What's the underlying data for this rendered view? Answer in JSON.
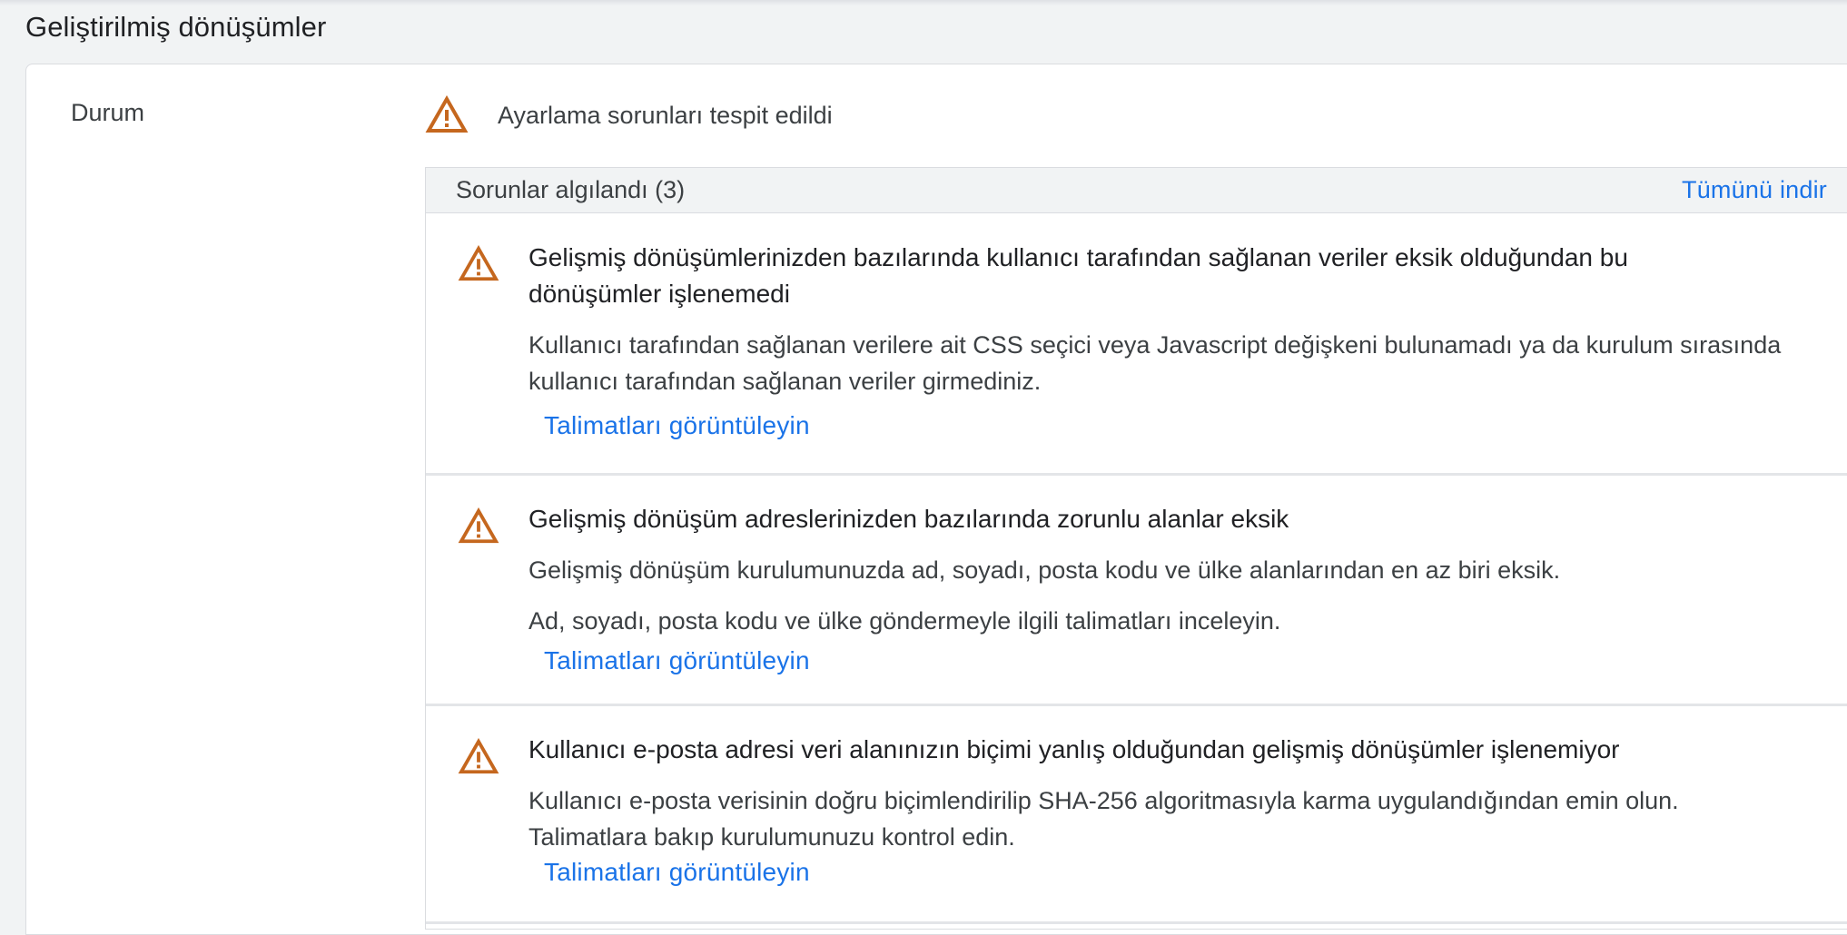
{
  "page": {
    "title": "Geliştirilmiş dönüşümler"
  },
  "status_row": {
    "label": "Durum",
    "status_text": "Ayarlama sorunları tespit edildi",
    "status_icon": "warning-icon",
    "warning_color": "#c5671e"
  },
  "issues": {
    "header": "Sorunlar algılandı (3)",
    "download_all": "Tümünü indir",
    "items": [
      {
        "title": "Gelişmiş dönüşümlerinizden bazılarında kullanıcı tarafından sağlanan veriler eksik olduğundan bu dönüşümler işlenemedi",
        "description": "Kullanıcı tarafından sağlanan verilere ait CSS seçici veya Javascript değişkeni bulunamadı ya da kurulum sırasında kullanıcı tarafından sağlanan veriler girmediniz.",
        "description2": "",
        "link": "Talimatları görüntüleyin"
      },
      {
        "title": "Gelişmiş dönüşüm adreslerinizden bazılarında zorunlu alanlar eksik",
        "description": "Gelişmiş dönüşüm kurulumunuzda ad, soyadı, posta kodu ve ülke alanlarından en az biri eksik.",
        "description2": "Ad, soyadı, posta kodu ve ülke göndermeyle ilgili talimatları inceleyin.",
        "link": "Talimatları görüntüleyin"
      },
      {
        "title": "Kullanıcı e-posta adresi veri alanınızın biçimi yanlış olduğundan gelişmiş dönüşümler işlenemiyor",
        "description": "Kullanıcı e-posta verisinin doğru biçimlendirilip SHA-256 algoritmasıyla karma uygulandığından emin olun. Talimatlara bakıp kurulumunuzu kontrol edin.",
        "description2": "",
        "link": "Talimatları görüntüleyin"
      }
    ]
  },
  "colors": {
    "link": "#1a73e8",
    "warning": "#c5671e",
    "background": "#f1f3f4"
  }
}
